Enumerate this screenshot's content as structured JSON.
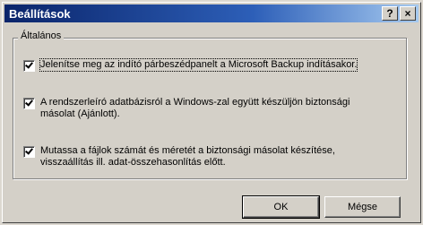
{
  "window": {
    "title": "Beállítások",
    "help_button": "?",
    "close_button": "×"
  },
  "group": {
    "label": "Általános"
  },
  "options": [
    {
      "label": "Jelenítse meg az indító párbeszédpanelt a Microsoft Backup indításakor.",
      "checked": true
    },
    {
      "label_line1": "A rendszerleíró adatbázisról a Windows-zal együtt készüljön biztonsági",
      "label_line2": "másolat (Ajánlott).",
      "checked": true
    },
    {
      "label_line1": "Mutassa a fájlok számát és méretét a biztonsági másolat készítése,",
      "label_line2": "visszaállítás ill. adat-összehasonlítás előtt.",
      "checked": true
    }
  ],
  "buttons": {
    "ok": "OK",
    "cancel": "Mégse"
  }
}
